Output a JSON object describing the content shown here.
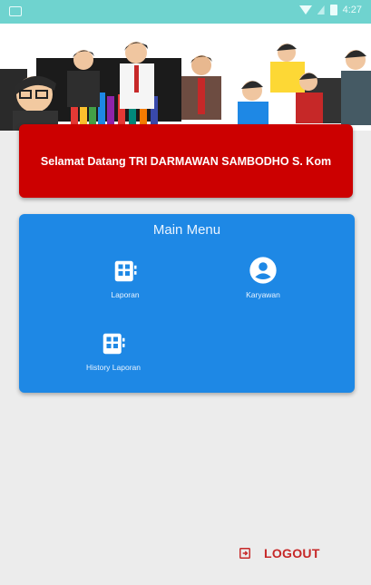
{
  "status_bar": {
    "time": "4:27"
  },
  "banner": {
    "welcome_text": "Selamat Datang  TRI DARMAWAN SAMBODHO S. Kom"
  },
  "main_menu": {
    "title": "Main Menu",
    "items": [
      {
        "label": "Laporan",
        "icon": "report-grid-icon"
      },
      {
        "label": "Karyawan",
        "icon": "account-circle-icon"
      },
      {
        "label": "History Laporan",
        "icon": "report-grid-icon"
      }
    ]
  },
  "logout": {
    "label": "LOGOUT"
  },
  "colors": {
    "status_bar": "#6fd3cf",
    "banner": "#cc0000",
    "menu_card": "#1e88e5",
    "logout_text": "#c62828",
    "background": "#ececec"
  }
}
